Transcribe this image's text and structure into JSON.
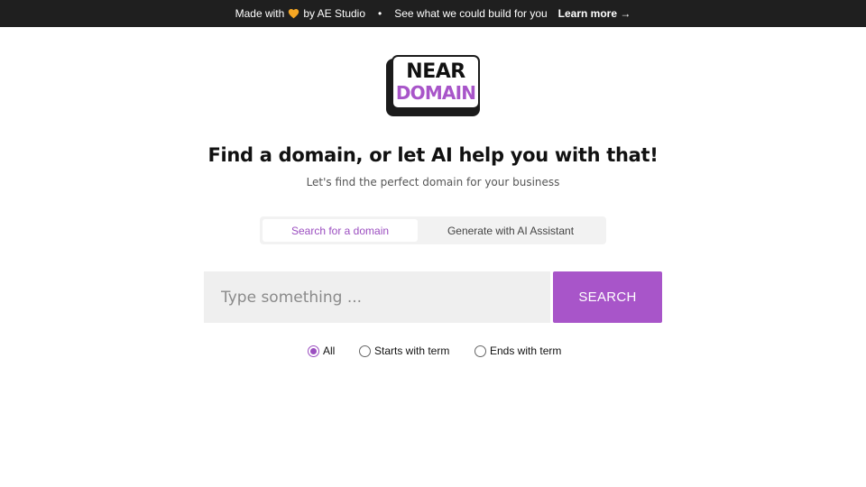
{
  "banner": {
    "made_with": "Made with",
    "by": "by AE Studio",
    "separator": "•",
    "pitch": "See what we could build for you",
    "learn_more": "Learn more →"
  },
  "logo": {
    "line1": "NEAR",
    "line2": "DOMAIN"
  },
  "hero": {
    "title": "Find a domain, or let AI help you with that!",
    "subtitle": "Let's find the perfect domain for your business"
  },
  "tabs": [
    {
      "label": "Search for a domain",
      "active": true
    },
    {
      "label": "Generate with AI Assistant",
      "active": false
    }
  ],
  "search": {
    "placeholder": "Type something ...",
    "value": "",
    "button_label": "SEARCH"
  },
  "filters": [
    {
      "label": "All",
      "checked": true
    },
    {
      "label": "Starts with term",
      "checked": false
    },
    {
      "label": "Ends with term",
      "checked": false
    }
  ],
  "colors": {
    "accent": "#a855c9",
    "topbar": "#1f1f1f",
    "heart": "#f5a623"
  },
  "icons": {
    "heart": "heart-icon"
  }
}
